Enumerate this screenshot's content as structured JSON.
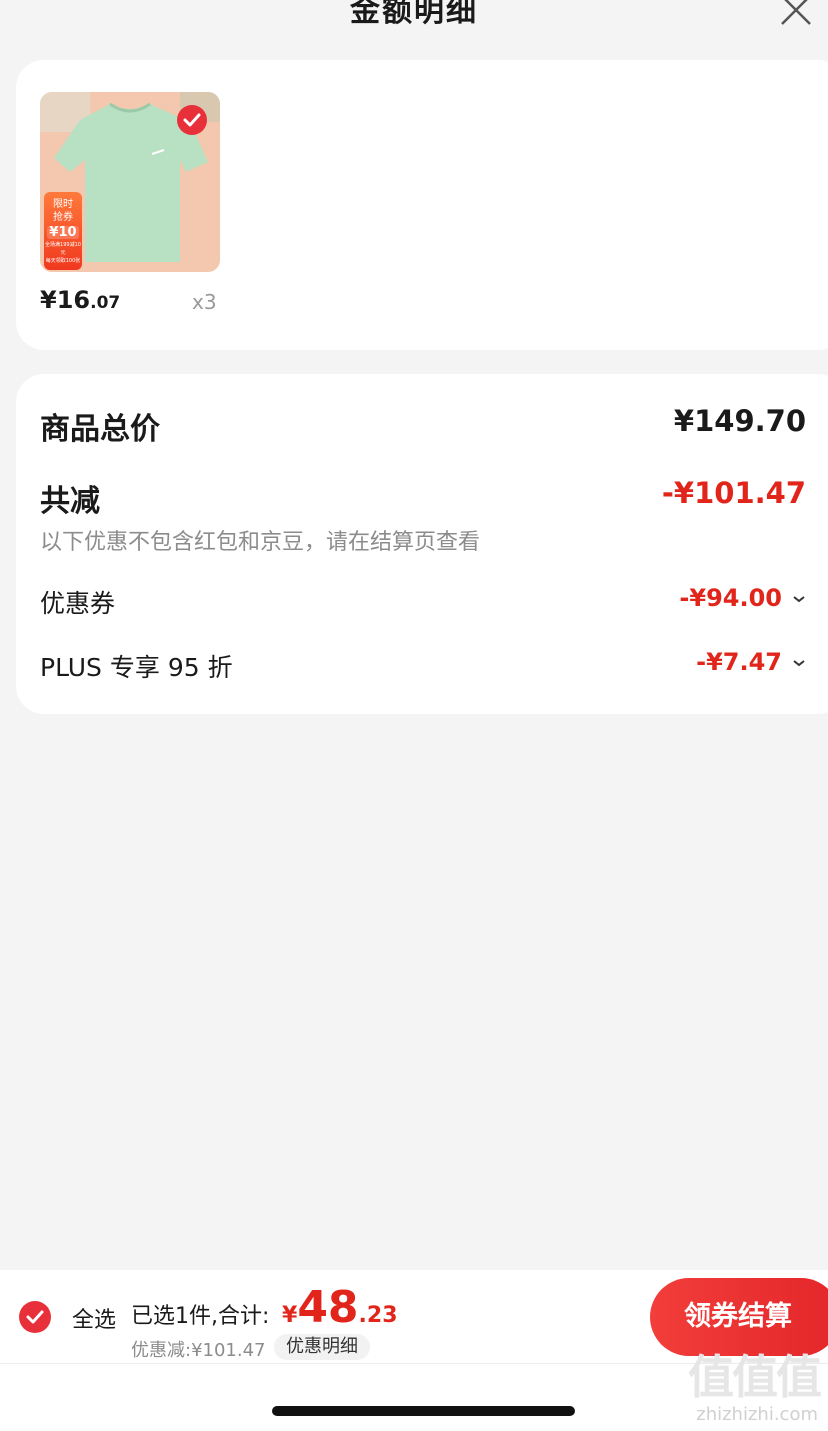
{
  "header": {
    "title": "金额明细"
  },
  "product": {
    "promo_line1": "限时",
    "promo_line2": "抢券",
    "promo_amount": "¥10",
    "promo_small1": "全场满199减10元",
    "promo_small2": "每天领取100张",
    "price_int": "¥16",
    "price_dec": ".07",
    "quantity": "x3"
  },
  "summary": {
    "total_label": "商品总价",
    "total_value": "¥149.70",
    "reduce_label": "共减",
    "reduce_value": "-¥101.47",
    "note": "以下优惠不包含红包和京豆，请在结算页查看",
    "coupon_label": "优惠券",
    "coupon_value": "-¥94.00",
    "plus_label": "PLUS 专享 95 折",
    "plus_value": "-¥7.47"
  },
  "bottom": {
    "select_all": "全选",
    "selected": "已选1件,合计:",
    "total_symbol": "¥",
    "total_int": "48",
    "total_dec": ".23",
    "discount": "优惠减:¥101.47",
    "detail_link": "优惠明细",
    "checkout": "领券结算"
  },
  "watermark": {
    "logo": "值值值",
    "url": "zhizhizhi.com"
  },
  "colors": {
    "accent": "#e1251b",
    "background": "#f4f4f4"
  },
  "icons": [
    "close-icon",
    "check-icon",
    "chevron-down-icon"
  ]
}
